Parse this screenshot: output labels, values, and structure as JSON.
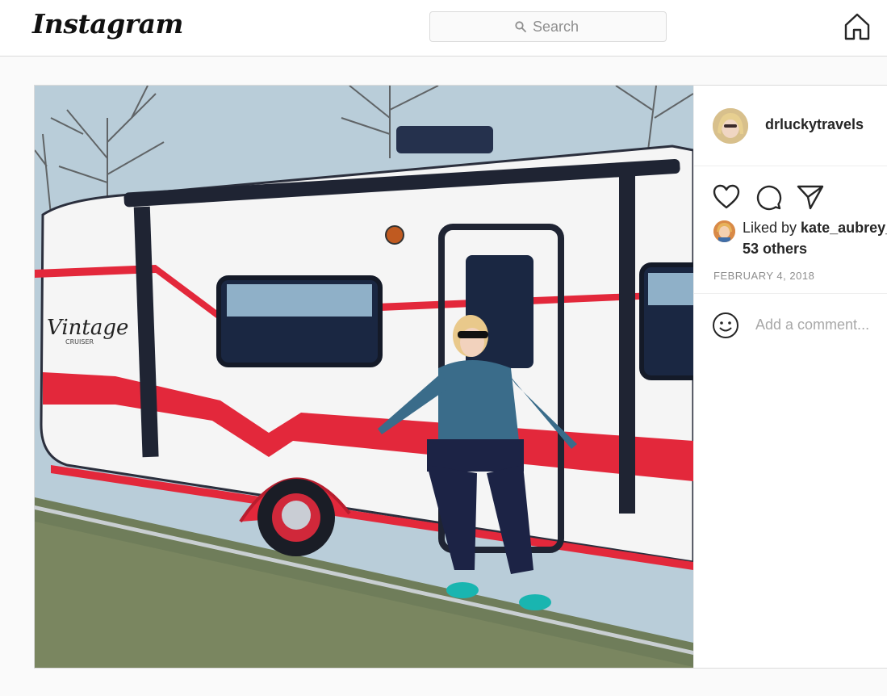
{
  "app": {
    "logo_text": "Instagram"
  },
  "search": {
    "placeholder": "Search"
  },
  "post": {
    "username": "drluckytravels",
    "liked_by_prefix": "Liked by ",
    "liked_by_user": "kate_aubrey_",
    "liked_others": "53 others",
    "date": "FEBRUARY 4, 2018",
    "comment_placeholder": "Add a comment...",
    "photo_sign_text": "Vintage",
    "photo_sign_subtext": "CRUISER"
  },
  "icons": {
    "search": "search-icon",
    "home": "home-icon",
    "like": "heart-icon",
    "comment": "comment-icon",
    "share": "paper-plane-icon",
    "emoji": "smiley-icon"
  },
  "colors": {
    "border": "#dbdbdb",
    "muted": "#8e8e8e",
    "text": "#262626",
    "trailer_red": "#e3283b"
  }
}
